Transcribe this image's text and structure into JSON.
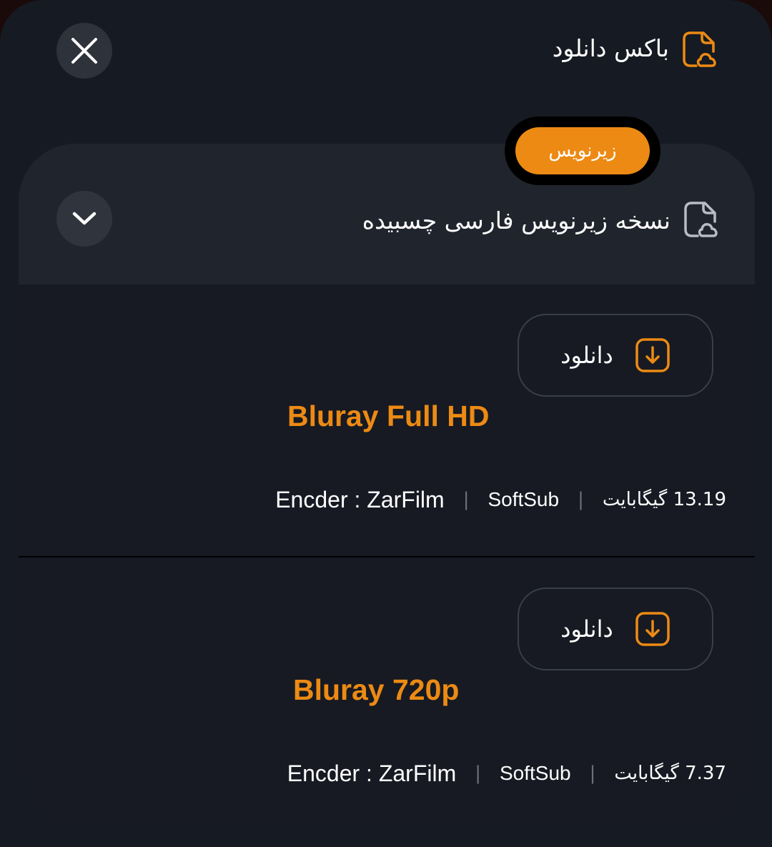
{
  "header": {
    "title": "باکس دانلود",
    "icon": "file-cloud-icon",
    "close_icon": "close-icon"
  },
  "section": {
    "badge": "زیرنویس",
    "title": "نسخه زیرنویس فارسی چسبیده",
    "icon": "file-cloud-icon",
    "toggle_icon": "chevron-down-icon"
  },
  "items": [
    {
      "download_label": "دانلود",
      "quality": "Bluray Full HD",
      "encoder": "Encder : ZarFilm",
      "sub_type": "SoftSub",
      "size": "13.19 گیگابایت"
    },
    {
      "download_label": "دانلود",
      "quality": "Bluray 720p",
      "encoder": "Encder : ZarFilm",
      "sub_type": "SoftSub",
      "size": "7.37 گیگابایت"
    }
  ],
  "colors": {
    "accent": "#ec8a14",
    "background": "#161a22",
    "card_header": "#20242d"
  }
}
